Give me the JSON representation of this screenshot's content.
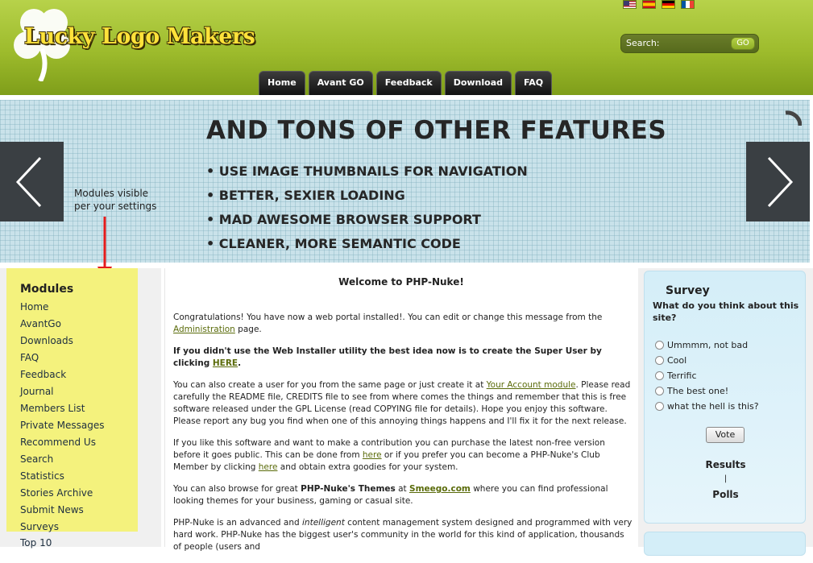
{
  "header": {
    "logo_text": "Lucky Logo Makers",
    "flags": [
      "us-flag-icon",
      "es-flag-icon",
      "de-flag-icon",
      "fr-flag-icon"
    ],
    "search_label": "Search:",
    "go_label": "GO",
    "nav": [
      "Home",
      "Avant GO",
      "Feedback",
      "Download",
      "FAQ"
    ]
  },
  "banner": {
    "title": "AND TONS OF OTHER FEATURES",
    "items": [
      "USE IMAGE THUMBNAILS FOR NAVIGATION",
      "BETTER, SEXIER LOADING",
      "MAD AWESOME BROWSER SUPPORT",
      "CLEANER, MORE SEMANTIC CODE"
    ],
    "note_line1": "Modules visible",
    "note_line2": "per your settings"
  },
  "modules": {
    "title": "Modules",
    "items": [
      "Home",
      "AvantGo",
      "Downloads",
      "FAQ",
      "Feedback",
      "Journal",
      "Members List",
      "Private Messages",
      "Recommend Us",
      "Search",
      "Statistics",
      "Stories Archive",
      "Submit News",
      "Surveys"
    ],
    "extra": "Top 10"
  },
  "main": {
    "title": "Welcome to PHP-Nuke!",
    "p1_text": "Congratulations! You have now a web portal installed!. You can edit or change this message from the ",
    "p1_link": "Administration",
    "p1_end": " page.",
    "p2_text": "If you didn't use the Web Installer utility the best idea now is to create the Super User by clicking ",
    "p2_link": "HERE",
    "p2_end": ".",
    "p3_text": "You can also create a user for you from the same page or just create it at ",
    "p3_link": "Your Account module",
    "p3_end": ". Please read carefully the README file, CREDITS file to see from where comes the things and remember that this is free software released under the GPL License (read COPYING file for details). Hope you enjoy this software. Please report any bug you find when one of this annoying things happens and I'll fix it for the next release.",
    "p4_text": "If you like this software and want to make a contribution you can purchase the latest non-free version before it goes public. This can be done from ",
    "p4_link1": "here",
    "p4_mid": " or if you prefer you can become a PHP-Nuke's Club Member by clicking ",
    "p4_link2": "here",
    "p4_end": " and obtain extra goodies for your system.",
    "p5_text": "You can also browse for great ",
    "p5_bold": "PHP-Nuke's Themes",
    "p5_mid": " at ",
    "p5_link": "Smeego.com",
    "p5_end": " where you can find professional looking themes for your business, gaming or casual site.",
    "p6_text": "PHP-Nuke is an advanced and ",
    "p6_italic": "intelligent",
    "p6_mid": " content management system designed and programmed with very hard work. PHP-Nuke has the biggest user's community in the world for this kind of application, thousands of people (users and"
  },
  "survey": {
    "title": "Survey",
    "question": "What do you think about this site?",
    "options": [
      "Ummmm, not bad",
      "Cool",
      "Terrific",
      "The best one!",
      "what the hell is this?"
    ],
    "vote_label": "Vote",
    "results_label": "Results",
    "separator": "|",
    "polls_label": "Polls"
  }
}
